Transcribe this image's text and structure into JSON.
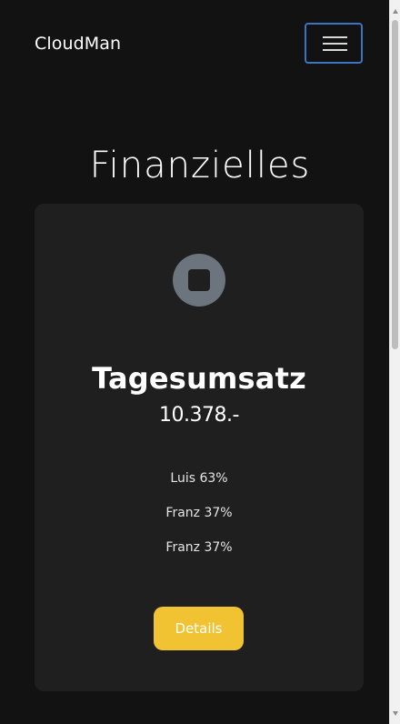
{
  "app": {
    "brand": "CloudMan"
  },
  "page": {
    "title": "Finanzielles"
  },
  "card": {
    "icon": "stop-circle-icon",
    "title": "Tagesumsatz",
    "amount": "10.378.-",
    "shares": [
      "Luis 63%",
      "Franz 37%",
      "Franz 37%"
    ],
    "button_label": "Details"
  },
  "colors": {
    "background": "#121212",
    "card": "#1f1f1f",
    "accent": "#f1c232",
    "focus": "#3d74c2",
    "icon": "#6c757d"
  },
  "icons": {
    "menu": "menu-icon",
    "status": "stop-circle-icon",
    "scroll_up": "scroll-up-icon",
    "scroll_down": "scroll-down-icon"
  }
}
